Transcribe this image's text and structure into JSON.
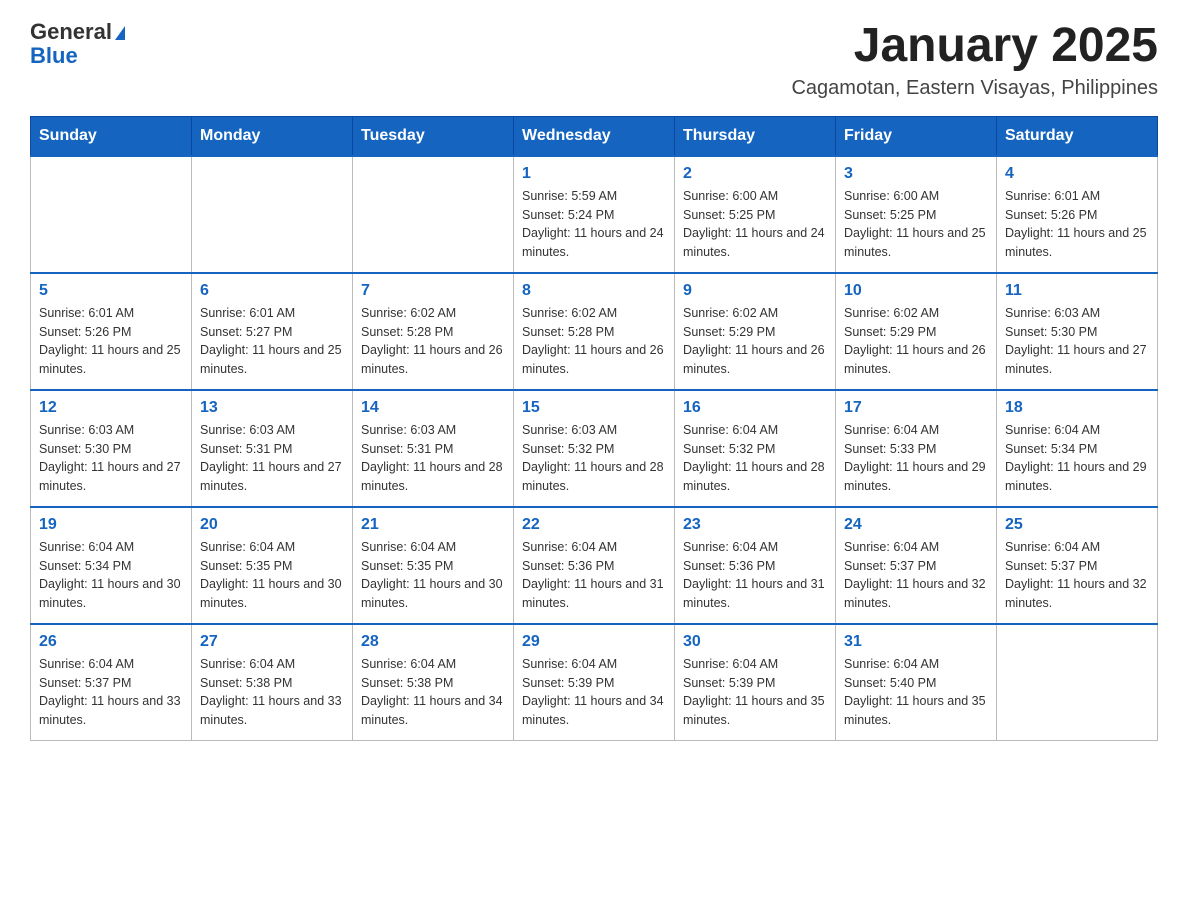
{
  "logo": {
    "text_general": "General",
    "text_blue": "Blue"
  },
  "header": {
    "month_title": "January 2025",
    "location": "Cagamotan, Eastern Visayas, Philippines"
  },
  "weekdays": [
    "Sunday",
    "Monday",
    "Tuesday",
    "Wednesday",
    "Thursday",
    "Friday",
    "Saturday"
  ],
  "weeks": [
    [
      {
        "day": "",
        "info": ""
      },
      {
        "day": "",
        "info": ""
      },
      {
        "day": "",
        "info": ""
      },
      {
        "day": "1",
        "info": "Sunrise: 5:59 AM\nSunset: 5:24 PM\nDaylight: 11 hours and 24 minutes."
      },
      {
        "day": "2",
        "info": "Sunrise: 6:00 AM\nSunset: 5:25 PM\nDaylight: 11 hours and 24 minutes."
      },
      {
        "day": "3",
        "info": "Sunrise: 6:00 AM\nSunset: 5:25 PM\nDaylight: 11 hours and 25 minutes."
      },
      {
        "day": "4",
        "info": "Sunrise: 6:01 AM\nSunset: 5:26 PM\nDaylight: 11 hours and 25 minutes."
      }
    ],
    [
      {
        "day": "5",
        "info": "Sunrise: 6:01 AM\nSunset: 5:26 PM\nDaylight: 11 hours and 25 minutes."
      },
      {
        "day": "6",
        "info": "Sunrise: 6:01 AM\nSunset: 5:27 PM\nDaylight: 11 hours and 25 minutes."
      },
      {
        "day": "7",
        "info": "Sunrise: 6:02 AM\nSunset: 5:28 PM\nDaylight: 11 hours and 26 minutes."
      },
      {
        "day": "8",
        "info": "Sunrise: 6:02 AM\nSunset: 5:28 PM\nDaylight: 11 hours and 26 minutes."
      },
      {
        "day": "9",
        "info": "Sunrise: 6:02 AM\nSunset: 5:29 PM\nDaylight: 11 hours and 26 minutes."
      },
      {
        "day": "10",
        "info": "Sunrise: 6:02 AM\nSunset: 5:29 PM\nDaylight: 11 hours and 26 minutes."
      },
      {
        "day": "11",
        "info": "Sunrise: 6:03 AM\nSunset: 5:30 PM\nDaylight: 11 hours and 27 minutes."
      }
    ],
    [
      {
        "day": "12",
        "info": "Sunrise: 6:03 AM\nSunset: 5:30 PM\nDaylight: 11 hours and 27 minutes."
      },
      {
        "day": "13",
        "info": "Sunrise: 6:03 AM\nSunset: 5:31 PM\nDaylight: 11 hours and 27 minutes."
      },
      {
        "day": "14",
        "info": "Sunrise: 6:03 AM\nSunset: 5:31 PM\nDaylight: 11 hours and 28 minutes."
      },
      {
        "day": "15",
        "info": "Sunrise: 6:03 AM\nSunset: 5:32 PM\nDaylight: 11 hours and 28 minutes."
      },
      {
        "day": "16",
        "info": "Sunrise: 6:04 AM\nSunset: 5:32 PM\nDaylight: 11 hours and 28 minutes."
      },
      {
        "day": "17",
        "info": "Sunrise: 6:04 AM\nSunset: 5:33 PM\nDaylight: 11 hours and 29 minutes."
      },
      {
        "day": "18",
        "info": "Sunrise: 6:04 AM\nSunset: 5:34 PM\nDaylight: 11 hours and 29 minutes."
      }
    ],
    [
      {
        "day": "19",
        "info": "Sunrise: 6:04 AM\nSunset: 5:34 PM\nDaylight: 11 hours and 30 minutes."
      },
      {
        "day": "20",
        "info": "Sunrise: 6:04 AM\nSunset: 5:35 PM\nDaylight: 11 hours and 30 minutes."
      },
      {
        "day": "21",
        "info": "Sunrise: 6:04 AM\nSunset: 5:35 PM\nDaylight: 11 hours and 30 minutes."
      },
      {
        "day": "22",
        "info": "Sunrise: 6:04 AM\nSunset: 5:36 PM\nDaylight: 11 hours and 31 minutes."
      },
      {
        "day": "23",
        "info": "Sunrise: 6:04 AM\nSunset: 5:36 PM\nDaylight: 11 hours and 31 minutes."
      },
      {
        "day": "24",
        "info": "Sunrise: 6:04 AM\nSunset: 5:37 PM\nDaylight: 11 hours and 32 minutes."
      },
      {
        "day": "25",
        "info": "Sunrise: 6:04 AM\nSunset: 5:37 PM\nDaylight: 11 hours and 32 minutes."
      }
    ],
    [
      {
        "day": "26",
        "info": "Sunrise: 6:04 AM\nSunset: 5:37 PM\nDaylight: 11 hours and 33 minutes."
      },
      {
        "day": "27",
        "info": "Sunrise: 6:04 AM\nSunset: 5:38 PM\nDaylight: 11 hours and 33 minutes."
      },
      {
        "day": "28",
        "info": "Sunrise: 6:04 AM\nSunset: 5:38 PM\nDaylight: 11 hours and 34 minutes."
      },
      {
        "day": "29",
        "info": "Sunrise: 6:04 AM\nSunset: 5:39 PM\nDaylight: 11 hours and 34 minutes."
      },
      {
        "day": "30",
        "info": "Sunrise: 6:04 AM\nSunset: 5:39 PM\nDaylight: 11 hours and 35 minutes."
      },
      {
        "day": "31",
        "info": "Sunrise: 6:04 AM\nSunset: 5:40 PM\nDaylight: 11 hours and 35 minutes."
      },
      {
        "day": "",
        "info": ""
      }
    ]
  ]
}
